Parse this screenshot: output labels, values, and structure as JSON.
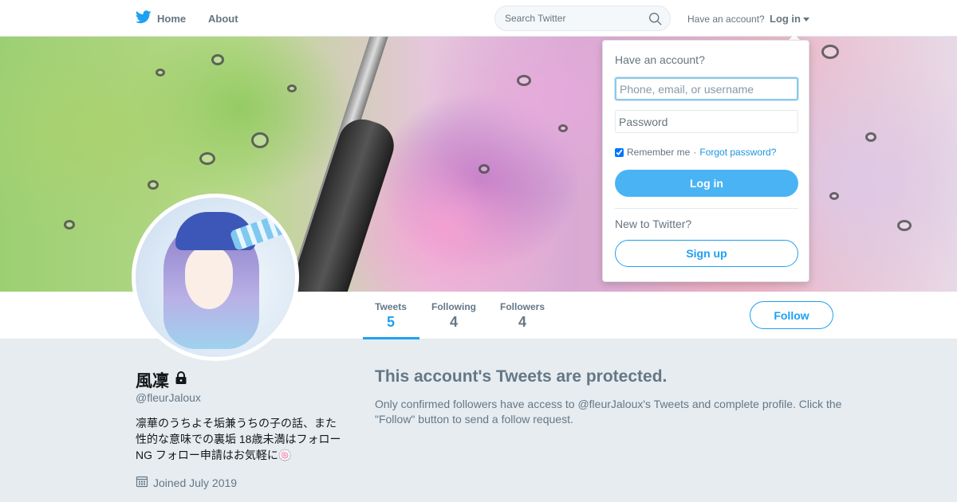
{
  "nav": {
    "home_label": "Home",
    "about_label": "About",
    "search_placeholder": "Search Twitter",
    "have_account": "Have an account?",
    "login_label": "Log in"
  },
  "profile": {
    "name": "風凜",
    "handle": "@fleurJaloux",
    "bio": "凛華のうちよそ垢兼うちの子の話、また性的な意味での裏垢 18歳未満はフォローNG フォロー申請はお気軽に🍥",
    "joined": "Joined July 2019",
    "locked": true
  },
  "stats": [
    {
      "label": "Tweets",
      "value": "5",
      "active": true
    },
    {
      "label": "Following",
      "value": "4",
      "active": false
    },
    {
      "label": "Followers",
      "value": "4",
      "active": false
    }
  ],
  "follow_label": "Follow",
  "protected": {
    "title": "This account's Tweets are protected.",
    "description": "Only confirmed followers have access to @fleurJaloux's Tweets and complete profile. Click the \"Follow\" button to send a follow request."
  },
  "login_dropdown": {
    "heading": "Have an account?",
    "username_placeholder": "Phone, email, or username",
    "password_placeholder": "Password",
    "remember_label": "Remember me",
    "remember_checked": true,
    "separator": " · ",
    "forgot_label": "Forgot password?",
    "login_button": "Log in",
    "new_to_twitter": "New to Twitter?",
    "signup_button": "Sign up"
  },
  "colors": {
    "accent": "#1da1f2",
    "login_button": "#4ab3f4",
    "page_background": "#e6ecf0",
    "muted_text": "#657786"
  },
  "icons": {
    "logo": "twitter-bird-icon",
    "search": "search-icon",
    "caret": "caret-down-icon",
    "lock": "lock-icon",
    "calendar": "calendar-icon"
  }
}
